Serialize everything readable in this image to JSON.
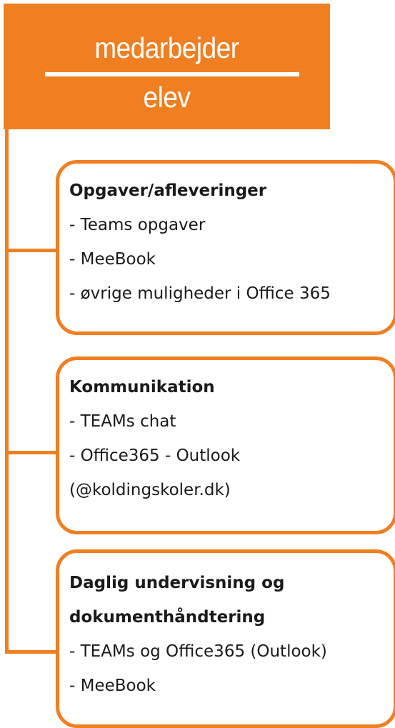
{
  "header": {
    "top_role": "medarbejder",
    "bottom_role": "elev",
    "color": "#f07f22"
  },
  "sections": [
    {
      "title": "Opgaver/afleveringer",
      "items": [
        "- Teams opgaver",
        "- MeeBook",
        "- øvrige muligheder i Office 365"
      ]
    },
    {
      "title": "Kommunikation",
      "items": [
        "- TEAMs chat",
        "- Office365 - Outlook",
        "(@koldingskoler.dk)"
      ]
    },
    {
      "title_lines": [
        "Daglig undervisning og",
        "dokumenthåndtering"
      ],
      "items": [
        "- TEAMs og Office365 (Outlook)",
        "- MeeBook"
      ]
    }
  ]
}
